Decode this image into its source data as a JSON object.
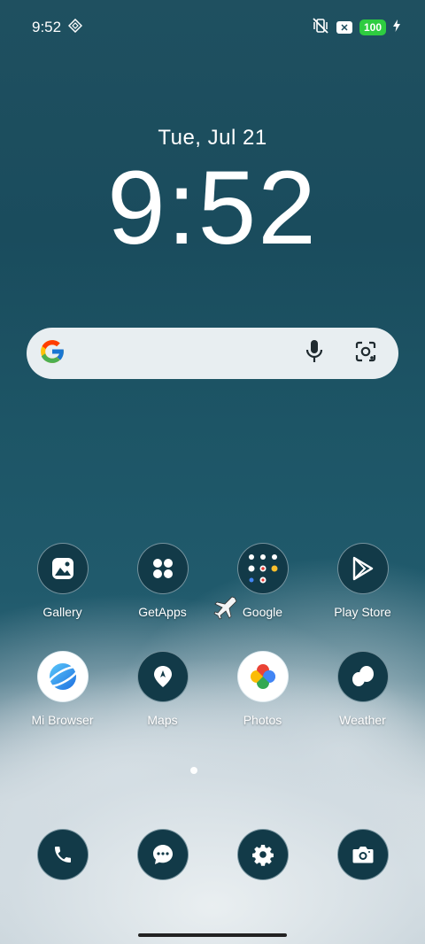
{
  "status_bar": {
    "time": "9:52",
    "battery": "100",
    "icons": [
      "nfc-diamond-icon",
      "vibrate-off-icon",
      "close-box-icon",
      "charging-bolt-icon"
    ]
  },
  "clock_widget": {
    "date": "Tue, Jul 21",
    "time": "9:52"
  },
  "search_bar": {
    "logo": "google-g-icon",
    "mic": "mic-icon",
    "lens": "lens-icon"
  },
  "apps_row1": [
    {
      "label": "Gallery",
      "icon": "gallery-icon"
    },
    {
      "label": "GetApps",
      "icon": "getapps-icon"
    },
    {
      "label": "Google",
      "icon": "google-folder-icon"
    },
    {
      "label": "Play Store",
      "icon": "play-store-icon"
    }
  ],
  "apps_row2": [
    {
      "label": "Mi Browser",
      "icon": "mi-browser-icon"
    },
    {
      "label": "Maps",
      "icon": "maps-icon"
    },
    {
      "label": "Photos",
      "icon": "photos-icon"
    },
    {
      "label": "Weather",
      "icon": "weather-icon"
    }
  ],
  "dock": [
    {
      "icon": "phone-icon"
    },
    {
      "icon": "messages-icon"
    },
    {
      "icon": "settings-icon"
    },
    {
      "icon": "camera-icon"
    }
  ],
  "colors": {
    "battery_green": "#2ecc40",
    "icon_bg": "#123a48",
    "search_bg": "#e8eef1"
  }
}
